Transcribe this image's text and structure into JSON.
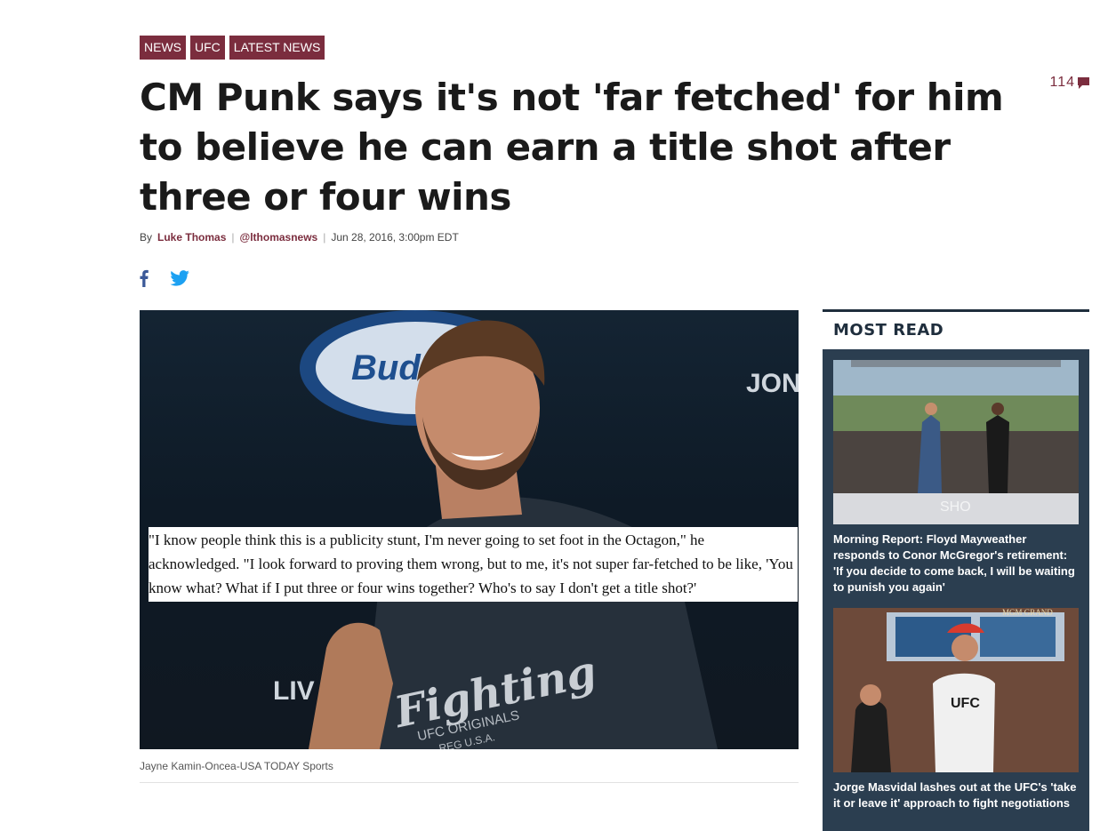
{
  "tags": [
    "NEWS",
    "UFC",
    "LATEST NEWS"
  ],
  "comments": {
    "count": "114"
  },
  "headline": "CM Punk says it's not 'far fetched' for him to believe he can earn a title shot after three or four wins",
  "byline": {
    "prefix": "By",
    "author": "Luke Thomas",
    "handle": "@lthomasnews",
    "date": "Jun 28, 2016, 3:00pm EDT"
  },
  "share": {
    "facebook_icon": "facebook-icon",
    "twitter_icon": "twitter-icon"
  },
  "hero": {
    "quote": "\"I know people think this is a publicity stunt, I'm never going to set foot in the Octagon,\" he acknowledged. \"I look forward to proving them wrong, but to me, it's not super far-fetched to be like, 'You know what? What if I put three or four wins together? Who's to say I don't get a title shot?'",
    "caption": "Jayne Kamin-Oncea-USA TODAY Sports",
    "photo_text": {
      "brand": "Bud Light",
      "jon": "JON",
      "live": "LIV",
      "shirt_word": "Fighting",
      "shirt_small": "UFC ORIGINALS",
      "shirt_reg": "REG U.S.A."
    }
  },
  "sidebar": {
    "heading": "MOST READ",
    "items": [
      {
        "title": "Morning Report: Floyd Mayweather responds to Conor McGregor's retirement: 'If you decide to come back, I will be waiting to punish you again'",
        "thumb_text": "SHO"
      },
      {
        "title": "Jorge Masvidal lashes out at the UFC's 'take it or leave it' approach to fight negotiations",
        "thumb_text": "MGM GRAND",
        "shirt_text": "UFC"
      }
    ]
  },
  "colors": {
    "accent": "#7b2d3e",
    "sidebar_bg": "#2b3e50",
    "sidebar_heading": "#1f2e3d",
    "twitter": "#1da1f2",
    "facebook": "#3b5998"
  }
}
